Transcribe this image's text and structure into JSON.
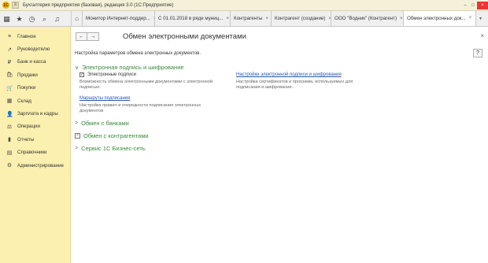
{
  "titlebar": {
    "logo": "1С",
    "title": "Бухгалтерия предприятия (базовая), редакция 3.0  (1С:Предприятие)",
    "controls": [
      "–",
      "□",
      "×"
    ]
  },
  "tabs": [
    {
      "label": "Монитор Интернет-поддер...",
      "close": "×"
    },
    {
      "label": "С 01.01.2018 в ряде муниц...",
      "close": "×"
    },
    {
      "label": "Контрагенты",
      "close": "×"
    },
    {
      "label": "Контрагент (создание)",
      "close": "×"
    },
    {
      "label": "ООО \"Водник\" (Контрагент)",
      "close": "×"
    },
    {
      "label": "Обмен электронных док...",
      "close": "×"
    }
  ],
  "tab_more": "▼",
  "sidebar": {
    "items": [
      {
        "label": "Главное",
        "icon": "≡"
      },
      {
        "label": "Руководителю",
        "icon": "↗"
      },
      {
        "label": "Банк и касса",
        "icon": "₽"
      },
      {
        "label": "Продажи",
        "icon": "🛍"
      },
      {
        "label": "Покупки",
        "icon": "🛒"
      },
      {
        "label": "Склад",
        "icon": "▦"
      },
      {
        "label": "Зарплата и кадры",
        "icon": "👤"
      },
      {
        "label": "Операции",
        "icon": "⚖"
      },
      {
        "label": "Отчеты",
        "icon": "▮"
      },
      {
        "label": "Справочники",
        "icon": "▤"
      },
      {
        "label": "Администрирование",
        "icon": "⚙"
      }
    ]
  },
  "form": {
    "back": "←",
    "forward": "→",
    "title": "Обмен электронными документами",
    "close": "×",
    "description": "Настройка параметров обмена электронных документов.",
    "help": "?",
    "sections": {
      "signature": {
        "chevron": "∨",
        "title": "Электронная подпись и шифрование",
        "checkbox_mark": "✓",
        "checkbox_label": "Электронные подписи",
        "checkbox_note_1": "Возможность обмена электронными документами с электронной",
        "checkbox_note_2": "подписью.",
        "link_settings": "Настройки электронной подписи и шифрования",
        "link_settings_note_1": "Настройка сертификатов и программ, используемых для",
        "link_settings_note_2": "подписания и шифрования.",
        "link_routes": "Маршруты подписания",
        "link_routes_note_1": "Настройка правил и очередности подписания электронных",
        "link_routes_note_2": "документов"
      },
      "banks": {
        "chevron": ">",
        "title": "Обмен с банками"
      },
      "contractors": {
        "chevron": ">",
        "title": "Обмен с контрагентами"
      },
      "service": {
        "chevron": ">",
        "title": "Сервис 1С Бизнес-сеть"
      }
    }
  }
}
